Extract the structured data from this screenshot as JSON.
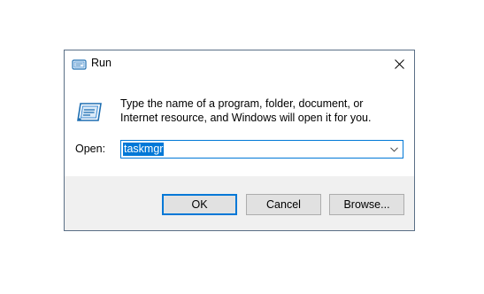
{
  "window": {
    "title": "Run",
    "icon": "run-icon",
    "close_icon": "close-icon"
  },
  "main": {
    "description": "Type the name of a program, folder, document, or Internet resource, and Windows will open it for you.",
    "app_icon": "run-icon",
    "open_label": "Open:",
    "open_value": "taskmgr",
    "dropdown_icon": "chevron-down-icon"
  },
  "buttons": {
    "ok": "OK",
    "cancel": "Cancel",
    "browse": "Browse..."
  },
  "colors": {
    "accent": "#0078d7",
    "border": "#5a6f86",
    "footer_bg": "#f0f0f0",
    "button_bg": "#e1e1e1"
  }
}
